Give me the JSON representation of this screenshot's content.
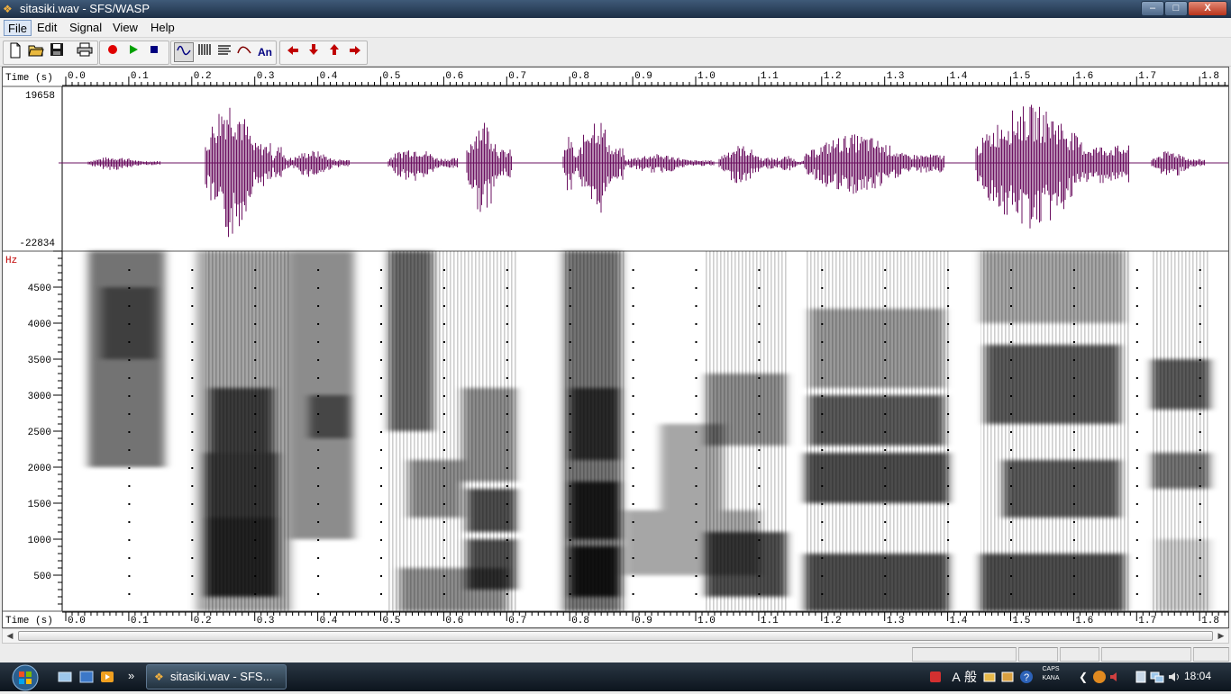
{
  "window": {
    "title": "sitasiki.wav - SFS/WASP",
    "minimize_glyph": "‒",
    "maximize_glyph": "□",
    "close_glyph": "X"
  },
  "menu": {
    "items": [
      "File",
      "Edit",
      "Signal",
      "View",
      "Help"
    ],
    "active": "File"
  },
  "toolbar": {
    "buttons": [
      "new-file-icon",
      "open-folder-icon",
      "save-icon",
      "print-icon",
      "record-icon",
      "play-icon",
      "stop-icon",
      "waveform-view-icon",
      "spectrogram-view-icon",
      "formant-view-icon",
      "pitch-view-icon",
      "annotation-view-icon",
      "arrow-left-icon",
      "arrow-down-icon",
      "arrow-up-icon",
      "arrow-right-icon"
    ],
    "annotation_label": "An",
    "pressed": "waveform-view-icon"
  },
  "timeaxis": {
    "label": "Time (s)",
    "ticks": [
      "0.0",
      "0.1",
      "0.2",
      "0.3",
      "0.4",
      "0.5",
      "0.6",
      "0.7",
      "0.8",
      "0.9",
      "1.0",
      "1.1",
      "1.2",
      "1.3",
      "1.4",
      "1.5",
      "1.6",
      "1.7",
      "1.8"
    ]
  },
  "waveform": {
    "ymax_label": "19658",
    "ymin_label": "-22834",
    "color": "#6b1060"
  },
  "spectrogram": {
    "unit_label": "Hz",
    "freq_ticks": [
      "4500",
      "4000",
      "3500",
      "3000",
      "2500",
      "2000",
      "1500",
      "1000",
      "500"
    ]
  },
  "taskbar": {
    "task_label": "sitasiki.wav - SFS...",
    "more_glyph": "»",
    "ime_glyphs": [
      "A",
      "般"
    ],
    "caps_label": "CAPS",
    "kana_label": "KANA",
    "clock": "18:04"
  },
  "colors": {
    "waveform": "#6b1060",
    "axis_text": "#000000",
    "hz_label": "#c00000",
    "record": "#e00000",
    "play": "#00a000",
    "stop": "#000080",
    "arrows": "#c00000",
    "accent": "#1d2f46"
  }
}
